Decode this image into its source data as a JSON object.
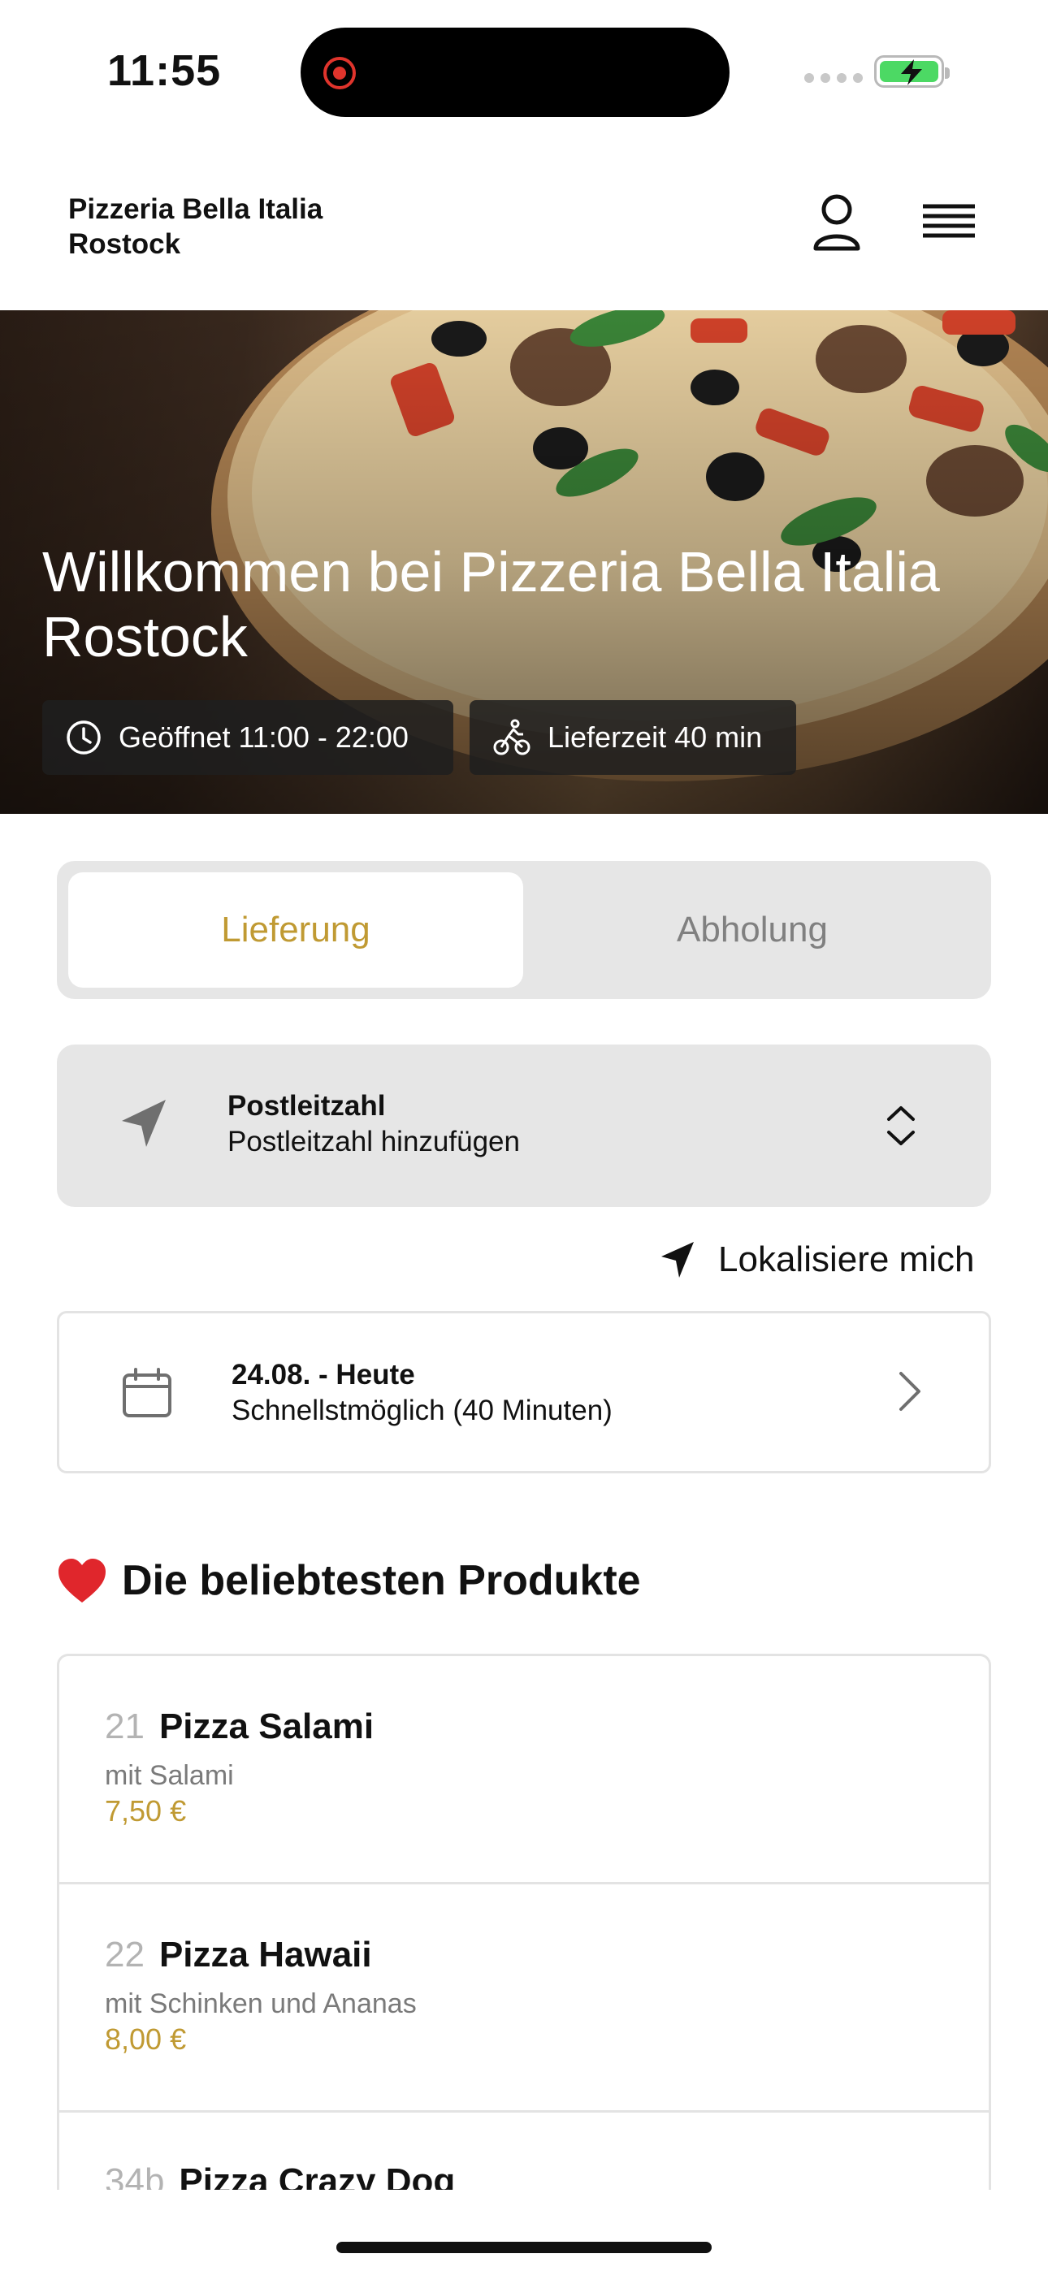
{
  "status_bar": {
    "time": "11:55"
  },
  "header": {
    "brand_line1": "Pizzeria Bella Italia",
    "brand_line2": "Rostock",
    "user_icon": "user-icon",
    "menu_icon": "hamburger-menu-icon"
  },
  "hero": {
    "title": "Willkommen bei Pizzeria Bella Italia Rostock",
    "hours": "Geöffnet 11:00 - 22:00",
    "delivery_time": "Lieferzeit 40 min"
  },
  "order_mode": {
    "options": [
      "Lieferung",
      "Abholung"
    ],
    "selected": "Lieferung",
    "accent_color": "#c09a33"
  },
  "postal": {
    "label": "Postleitzahl",
    "placeholder": "Postleitzahl hinzufügen"
  },
  "locate_label": "Lokalisiere mich",
  "schedule": {
    "date": "24.08. - Heute",
    "time": "Schnellstmöglich (40 Minuten)"
  },
  "popular": {
    "title": "Die beliebtesten Produkte",
    "emoji": "❤️",
    "items": [
      {
        "number": "21",
        "name": "Pizza Salami",
        "description": "mit Salami",
        "price": "7,50 €"
      },
      {
        "number": "22",
        "name": "Pizza Hawaii",
        "description": "mit Schinken und Ananas",
        "price": "8,00 €"
      },
      {
        "number": "34b",
        "name": "Pizza Crazy Dog",
        "description": "",
        "price": ""
      }
    ]
  }
}
